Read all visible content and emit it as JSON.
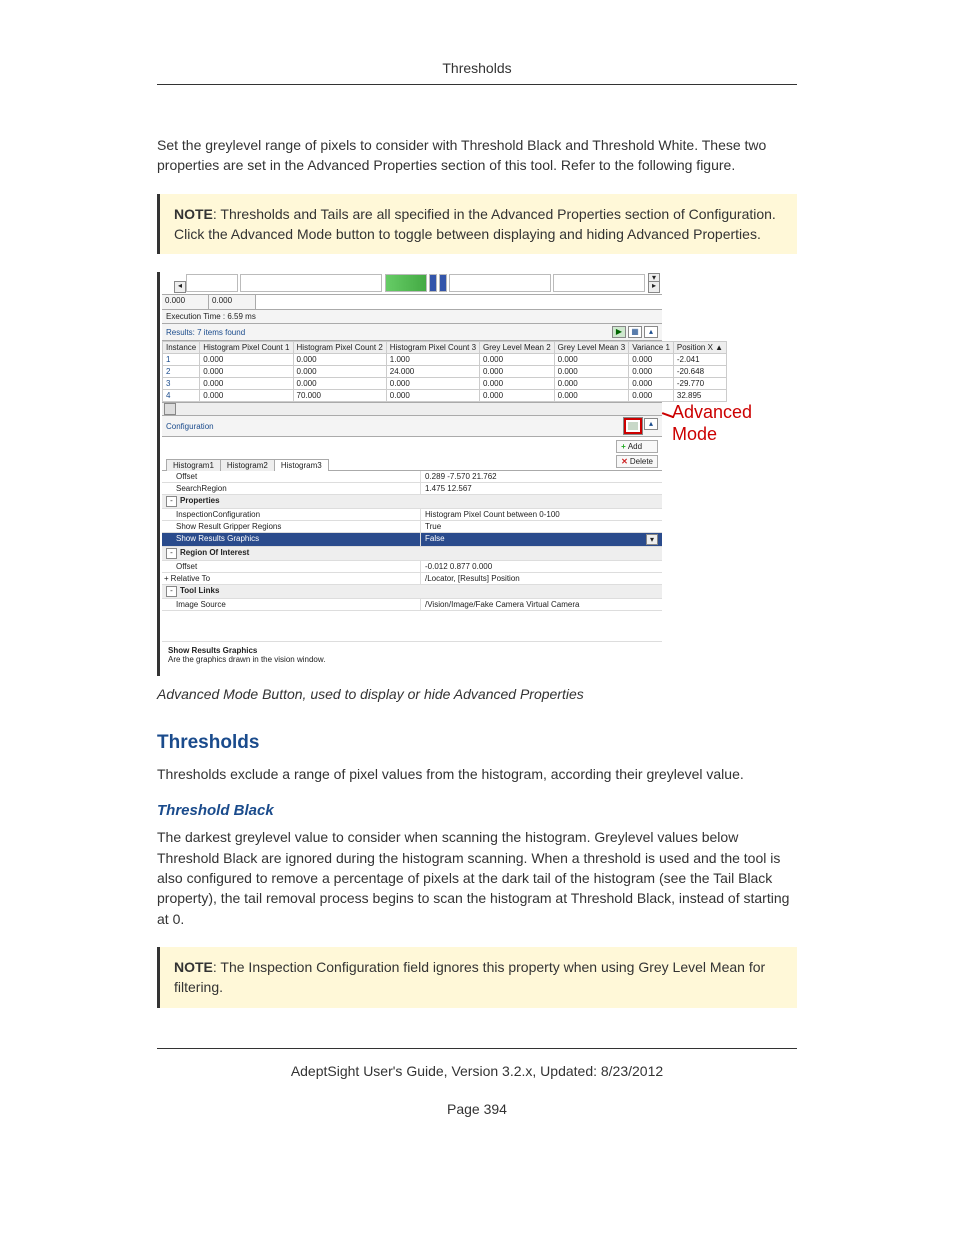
{
  "page_header": "Thresholds",
  "intro_p": "Set the greylevel range of pixels to consider with Threshold Black and Threshold White. These two properties are set in the Advanced Properties section of this tool. Refer to the following figure.",
  "note1_label": "NOTE",
  "note1_body": ": Thresholds and Tails are all specified in the Advanced Properties section of Configuration. Click the Advanced Mode button to toggle between displaying and hiding Advanced Properties.",
  "screenshot": {
    "coord1": "0.000",
    "coord2": "0.000",
    "exec_time": "Execution Time : 6.59 ms",
    "results_label": "Results: 7 items found",
    "columns": [
      "Instance",
      "Histogram Pixel Count 1",
      "Histogram Pixel Count 2",
      "Histogram Pixel Count 3",
      "Grey Level Mean 2",
      "Grey Level Mean 3",
      "Variance 1",
      "Position X"
    ],
    "rows": [
      [
        "1",
        "0.000",
        "0.000",
        "1.000",
        "0.000",
        "0.000",
        "0.000",
        "-2.041"
      ],
      [
        "2",
        "0.000",
        "0.000",
        "24.000",
        "0.000",
        "0.000",
        "0.000",
        "-20.648"
      ],
      [
        "3",
        "0.000",
        "0.000",
        "0.000",
        "0.000",
        "0.000",
        "0.000",
        "-29.770"
      ],
      [
        "4",
        "0.000",
        "70.000",
        "0.000",
        "0.000",
        "0.000",
        "0.000",
        "32.895"
      ]
    ],
    "config_label": "Configuration",
    "tabs": [
      "Histogram1",
      "Histogram2",
      "Histogram3"
    ],
    "active_tab": 2,
    "add_label": "Add",
    "delete_label": "Delete",
    "tab_rows": [
      {
        "k": "Offset",
        "v": "0.289 -7.570 21.762"
      },
      {
        "k": "SearchRegion",
        "v": "1.475 12.567"
      }
    ],
    "groups": [
      {
        "label": "Properties",
        "expanded": "-",
        "rows": [
          {
            "k": "InspectionConfiguration",
            "v": "Histogram Pixel Count between 0-100"
          },
          {
            "k": "Show Result Gripper Regions",
            "v": "True"
          },
          {
            "k": "Show Results Graphics",
            "v": "False",
            "selected": true
          }
        ]
      },
      {
        "label": "Region Of Interest",
        "expanded": "-",
        "rows": [
          {
            "k": "Offset",
            "v": "-0.012 0.877 0.000"
          },
          {
            "k": "Relative To",
            "v": "/Locator, [Results] Position",
            "toggle": "+"
          }
        ]
      },
      {
        "label": "Tool Links",
        "expanded": "-",
        "rows": [
          {
            "k": "Image Source",
            "v": "/Vision/Image/Fake Camera Virtual Camera"
          }
        ]
      }
    ],
    "help_title": "Show Results Graphics",
    "help_body": "Are the graphics drawn in the vision window."
  },
  "callout": "Advanced Mode",
  "caption": "Advanced Mode Button, used to display or hide Advanced Properties",
  "section_h2": "Thresholds",
  "section_p": "Thresholds exclude a range of pixel values from the histogram, according their greylevel value.",
  "sub_h3": "Threshold Black",
  "sub_p": "The darkest greylevel value to consider when scanning the histogram. Greylevel values below Threshold Black are ignored during the histogram scanning. When a threshold is used and the tool is also configured to remove a percentage of pixels at the dark tail of the histogram (see the Tail Black property), the tail removal process begins to scan the histogram at Threshold Black, instead of starting at 0.",
  "note2_label": "NOTE",
  "note2_body": ": The Inspection Configuration field ignores this property when using Grey Level Mean for filtering.",
  "footer_line": "AdeptSight User's Guide,  Version 3.2.x, Updated: 8/23/2012",
  "page_number": "Page 394"
}
